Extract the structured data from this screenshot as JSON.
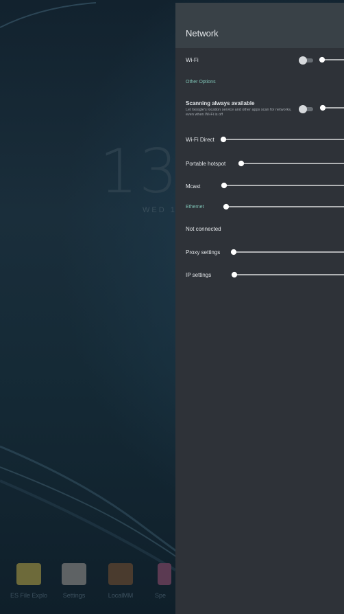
{
  "home": {
    "clock": "13",
    "date": "WED 1",
    "dock": [
      {
        "label": "ES File Explo",
        "color": "#6d6a3a"
      },
      {
        "label": "Settings",
        "color": "#5e6264"
      },
      {
        "label": "LocalMM",
        "color": "#4a3b2e"
      },
      {
        "label": "Spe",
        "color": "#5b3a52"
      }
    ]
  },
  "panel": {
    "title": "Network",
    "wifi": {
      "label": "Wi-Fi",
      "toggle_on": false
    },
    "other_options_header": "Other Options",
    "scanning": {
      "label": "Scanning always available",
      "description": "Let Google's location service and other apps scan for networks, even when Wi-Fi is off",
      "toggle_on": false
    },
    "wifi_direct": "Wi-Fi Direct",
    "portable_hotspot": "Portable hotspot",
    "mcast": "Mcast",
    "ethernet_header": "Ethernet",
    "ethernet_status": "Not connected",
    "proxy_settings": "Proxy settings",
    "ip_settings": "IP settings"
  },
  "colors": {
    "panel_bg": "#2e3238",
    "header_bg": "#394147",
    "accent": "#7fc3b5"
  }
}
